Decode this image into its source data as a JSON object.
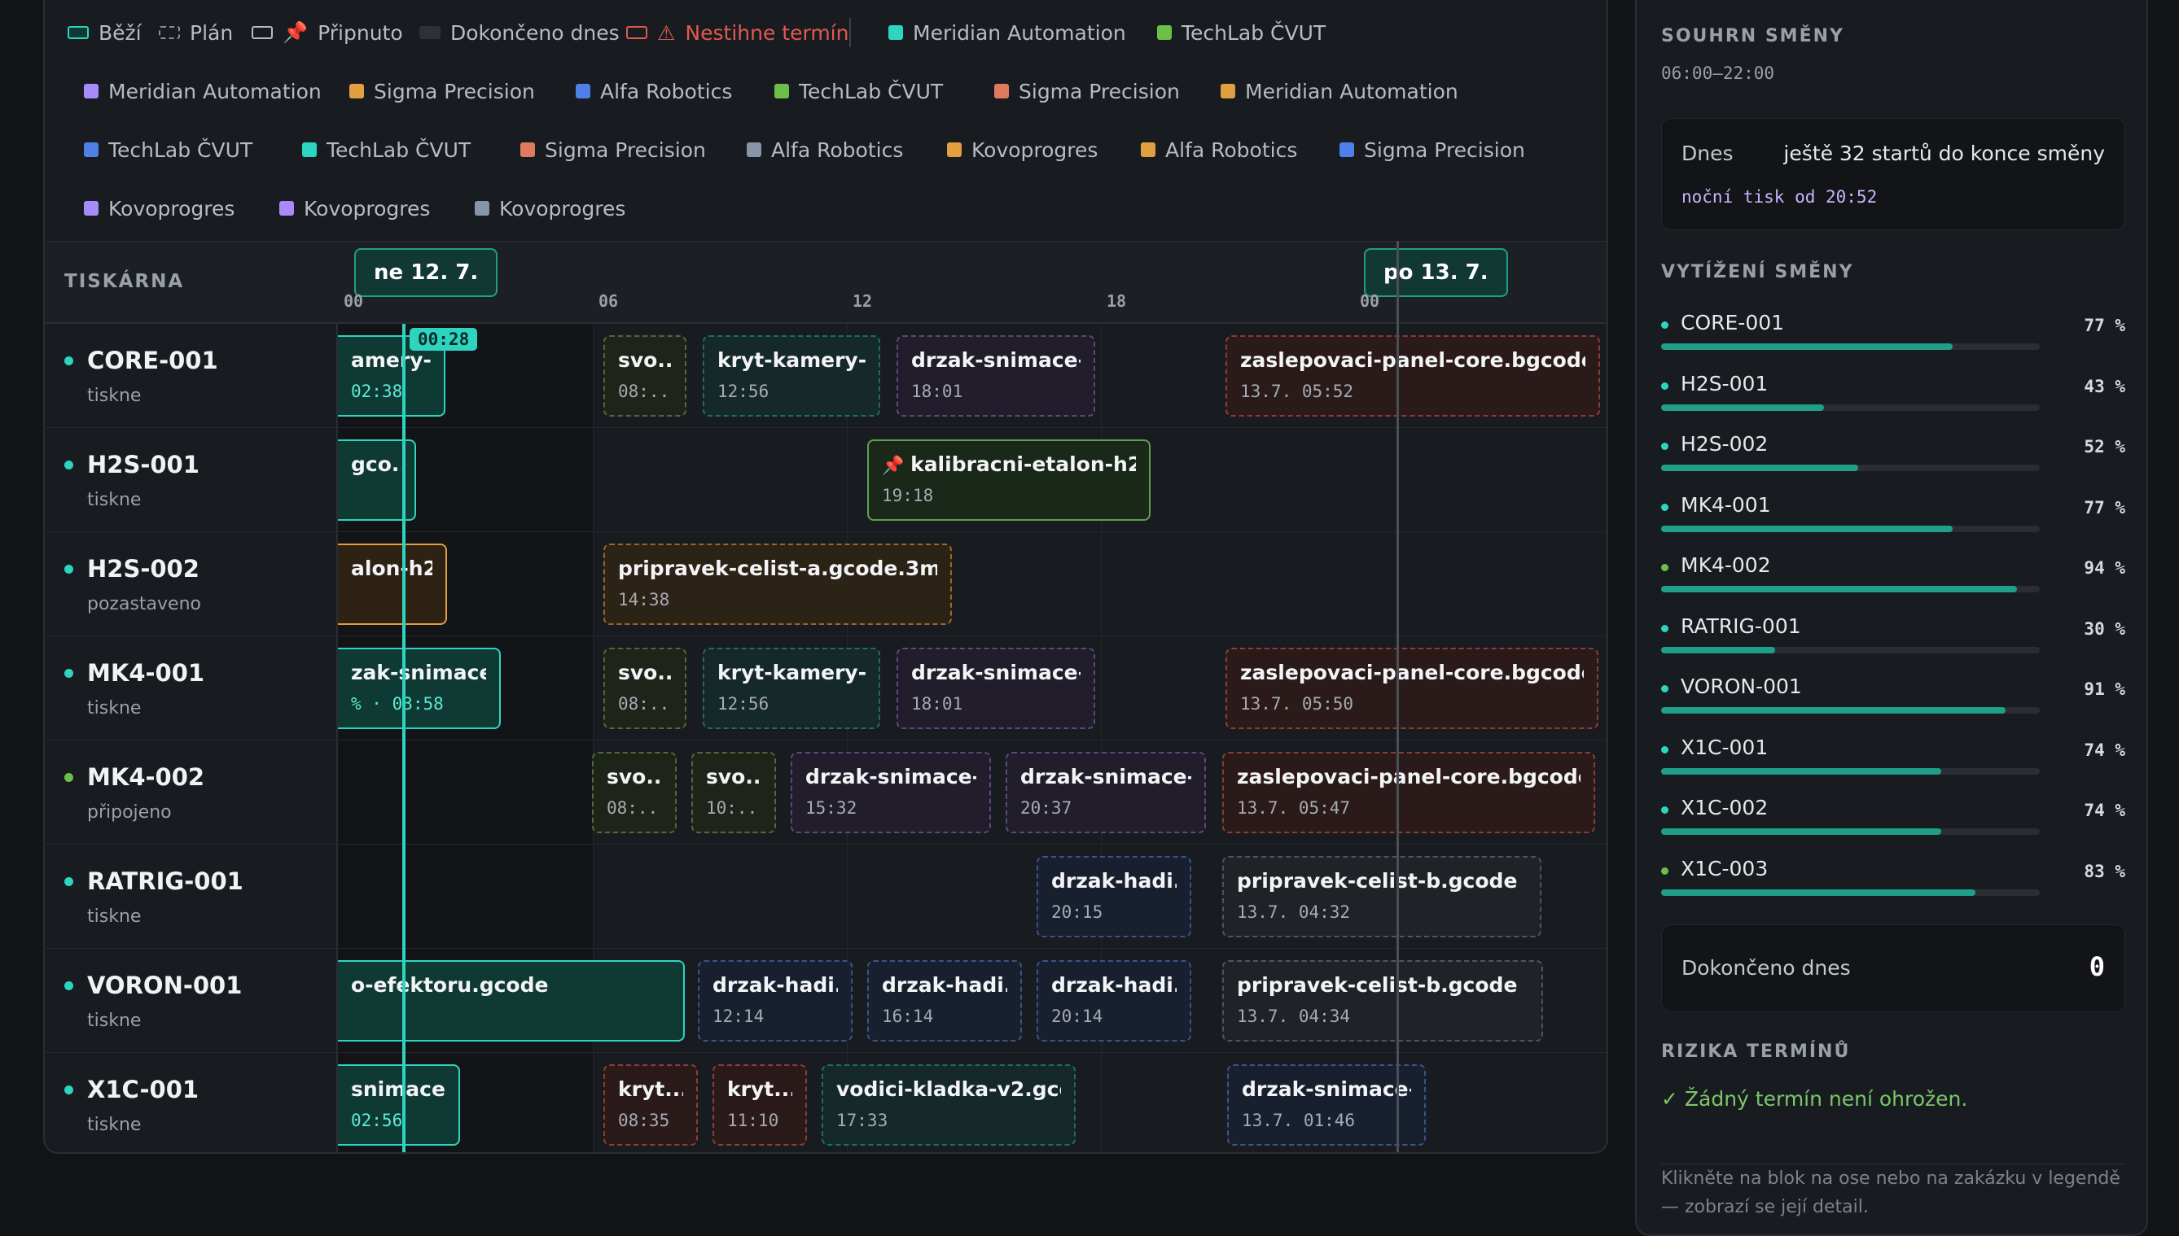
{
  "legend": {
    "status": [
      {
        "label": "Běží",
        "icon": "running-swatch-icon"
      },
      {
        "label": "Plán",
        "icon": "plan-swatch-icon"
      },
      {
        "label": "Připnuto",
        "icon": "pin-icon"
      },
      {
        "label": "Dokončeno dnes",
        "icon": "done-swatch-icon"
      },
      {
        "label": "Nestihne termín",
        "icon": "warning-icon"
      }
    ],
    "jobs": [
      {
        "label": "Meridian Automation",
        "color": "#2dd4bf"
      },
      {
        "label": "TechLab ČVUT",
        "color": "#6cc04a"
      },
      {
        "label": "Meridian Automation",
        "color": "#a78bfa"
      },
      {
        "label": "Sigma Precision",
        "color": "#e0a040"
      },
      {
        "label": "Alfa Robotics",
        "color": "#4f7fe8"
      },
      {
        "label": "TechLab ČVUT",
        "color": "#6cc04a"
      },
      {
        "label": "Sigma Precision",
        "color": "#e07a5f"
      },
      {
        "label": "Meridian Automation",
        "color": "#e0a040"
      },
      {
        "label": "TechLab ČVUT",
        "color": "#4f7fe8"
      },
      {
        "label": "TechLab ČVUT",
        "color": "#2dd4bf"
      },
      {
        "label": "Sigma Precision",
        "color": "#e07a5f"
      },
      {
        "label": "Alfa Robotics",
        "color": "#8895a7"
      },
      {
        "label": "Kovoprogres",
        "color": "#e0a040"
      },
      {
        "label": "Alfa Robotics",
        "color": "#e0a040"
      },
      {
        "label": "Sigma Precision",
        "color": "#4f7fe8"
      },
      {
        "label": "Kovoprogres",
        "color": "#a78bfa"
      },
      {
        "label": "Kovoprogres",
        "color": "#a78bfa"
      },
      {
        "label": "Kovoprogres",
        "color": "#8895a7"
      }
    ]
  },
  "timeline": {
    "column_header": "TISKÁRNA",
    "dates": [
      "ne 12. 7.",
      "po 13. 7."
    ],
    "hours": [
      "00",
      "06",
      "12",
      "18",
      "00"
    ],
    "now": "00:28"
  },
  "printers": [
    {
      "name": "CORE-001",
      "status": "tiskne"
    },
    {
      "name": "H2S-001",
      "status": "tiskne"
    },
    {
      "name": "H2S-002",
      "status": "pozastaveno"
    },
    {
      "name": "MK4-001",
      "status": "tiskne"
    },
    {
      "name": "MK4-002",
      "status": "připojeno"
    },
    {
      "name": "RATRIG-001",
      "status": "tiskne"
    },
    {
      "name": "VORON-001",
      "status": "tiskne"
    },
    {
      "name": "X1C-001",
      "status": "tiskne"
    }
  ],
  "blocks": {
    "core": [
      {
        "title": "amery-...",
        "sub": "02:38"
      },
      {
        "title": "svo...",
        "sub": "08:..."
      },
      {
        "title": "kryt-kamery-...",
        "sub": "12:56"
      },
      {
        "title": "drzak-snimace-...",
        "sub": "18:01"
      },
      {
        "title": "zaslepovaci-panel-core.bgcode",
        "sub": "13.7. 05:52"
      }
    ],
    "h2s1": [
      {
        "title": "gco...",
        "sub": ""
      },
      {
        "title": "kalibracni-etalon-h2...",
        "sub": "19:18"
      }
    ],
    "h2s2": [
      {
        "title": "alon-h2s...",
        "sub": ""
      },
      {
        "title": "pripravek-celist-a.gcode.3mf",
        "sub": "14:38"
      }
    ],
    "mk41": [
      {
        "title": "zak-snimace-...",
        "sub": "% · 03:58"
      },
      {
        "title": "svo...",
        "sub": "08:..."
      },
      {
        "title": "kryt-kamery-...",
        "sub": "12:56"
      },
      {
        "title": "drzak-snimace-...",
        "sub": "18:01"
      },
      {
        "title": "zaslepovaci-panel-core.bgcode",
        "sub": "13.7. 05:50"
      }
    ],
    "mk42": [
      {
        "title": "svo...",
        "sub": "08:..."
      },
      {
        "title": "svo...",
        "sub": "10:..."
      },
      {
        "title": "drzak-snimace-...",
        "sub": "15:32"
      },
      {
        "title": "drzak-snimace-...",
        "sub": "20:37"
      },
      {
        "title": "zaslepovaci-panel-core.bgcode",
        "sub": "13.7. 05:47"
      }
    ],
    "ratrig": [
      {
        "title": "drzak-hadi...",
        "sub": "20:15"
      },
      {
        "title": "pripravek-celist-b.gcode",
        "sub": "13.7. 04:32"
      }
    ],
    "voron": [
      {
        "title": "o-efektoru.gcode",
        "sub": ""
      },
      {
        "title": "drzak-hadi...",
        "sub": "12:14"
      },
      {
        "title": "drzak-hadi...",
        "sub": "16:14"
      },
      {
        "title": "drzak-hadi...",
        "sub": "20:14"
      },
      {
        "title": "pripravek-celist-b.gcode",
        "sub": "13.7. 04:34"
      }
    ],
    "x1c": [
      {
        "title": "snimace-...",
        "sub": "02:56"
      },
      {
        "title": "kryt...",
        "sub": "08:35"
      },
      {
        "title": "kryt...",
        "sub": "11:10"
      },
      {
        "title": "vodici-kladka-v2.gco...",
        "sub": "17:33"
      },
      {
        "title": "drzak-snimace-...",
        "sub": "13.7. 01:46"
      }
    ]
  },
  "summary": {
    "title": "SOUHRN SMĚNY",
    "shift": "06:00–22:00",
    "today_label": "Dnes",
    "today_value": "ještě 32 startů do konce směny",
    "night": "noční tisk od 20:52",
    "util_title": "VYTÍŽENÍ SMĚNY",
    "utilization": [
      {
        "name": "CORE-001",
        "pct": 77,
        "pct_label": "77 %"
      },
      {
        "name": "H2S-001",
        "pct": 43,
        "pct_label": "43 %"
      },
      {
        "name": "H2S-002",
        "pct": 52,
        "pct_label": "52 %"
      },
      {
        "name": "MK4-001",
        "pct": 77,
        "pct_label": "77 %"
      },
      {
        "name": "MK4-002",
        "pct": 94,
        "pct_label": "94 %"
      },
      {
        "name": "RATRIG-001",
        "pct": 30,
        "pct_label": "30 %"
      },
      {
        "name": "VORON-001",
        "pct": 91,
        "pct_label": "91 %"
      },
      {
        "name": "X1C-001",
        "pct": 74,
        "pct_label": "74 %"
      },
      {
        "name": "X1C-002",
        "pct": 74,
        "pct_label": "74 %"
      },
      {
        "name": "X1C-003",
        "pct": 83,
        "pct_label": "83 %"
      }
    ],
    "done_label": "Dokončeno dnes",
    "done_value": "0",
    "risk_title": "RIZIKA TERMÍNŮ",
    "risk_ok": "✓ Žádný termín není ohrožen.",
    "hint": "Klikněte na blok na ose nebo na zakázku v legendě — zobrazí se její detail."
  }
}
